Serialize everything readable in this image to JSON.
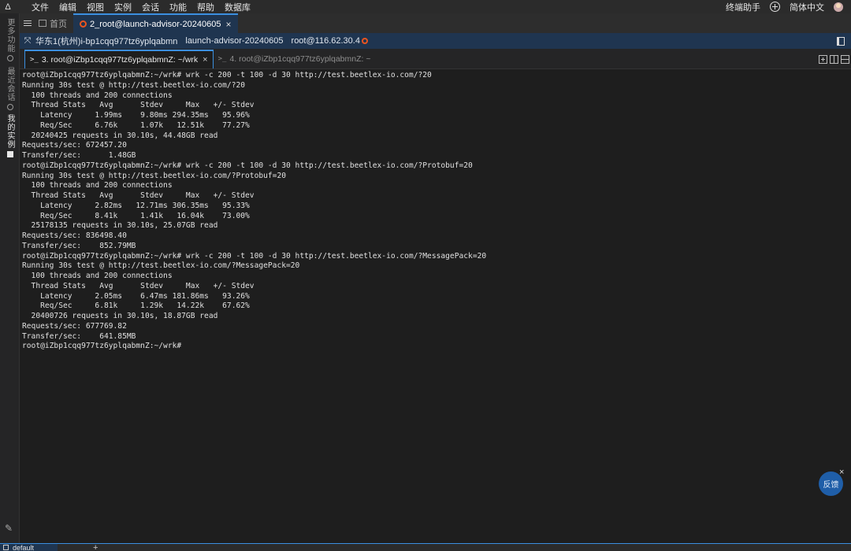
{
  "menubar": {
    "logo": "Δ",
    "items": [
      "文件",
      "编辑",
      "视图",
      "实例",
      "会话",
      "功能",
      "帮助",
      "数据库"
    ],
    "terminal_assistant": "终端助手",
    "language": "简体中文"
  },
  "sidebar": {
    "tabs": [
      {
        "label": "更多功能"
      },
      {
        "label": "我的实例"
      },
      {
        "label": "最近会话"
      }
    ]
  },
  "tabbar": {
    "home_label": "首页",
    "session_tab_label": "2_root@launch-advisor-20240605",
    "close_glyph": "×"
  },
  "infobar": {
    "region": "华东1(杭州)",
    "instance_id": "i-bp1cqq977tz6yplqabmn",
    "instance_name": "launch-advisor-20240605",
    "user_host": "root@116.62.30.4"
  },
  "subtabs": [
    {
      "label": "3. root@iZbp1cqq977tz6yplqabmnZ: ~/wrk"
    },
    {
      "label": "4. root@iZbp1cqq977tz6yplqabmnZ: ~"
    }
  ],
  "terminal": {
    "lines": [
      "root@iZbp1cqq977tz6yplqabmnZ:~/wrk# wrk -c 200 -t 100 -d 30 http://test.beetlex-io.com/?20",
      "Running 30s test @ http://test.beetlex-io.com/?20",
      "  100 threads and 200 connections",
      "  Thread Stats   Avg      Stdev     Max   +/- Stdev",
      "    Latency     1.99ms    9.80ms 294.35ms   95.96%",
      "    Req/Sec     6.76k     1.07k   12.51k    77.27%",
      "  20240425 requests in 30.10s, 44.48GB read",
      "Requests/sec: 672457.20",
      "Transfer/sec:      1.48GB",
      "root@iZbp1cqq977tz6yplqabmnZ:~/wrk# wrk -c 200 -t 100 -d 30 http://test.beetlex-io.com/?Protobuf=20",
      "Running 30s test @ http://test.beetlex-io.com/?Protobuf=20",
      "  100 threads and 200 connections",
      "  Thread Stats   Avg      Stdev     Max   +/- Stdev",
      "    Latency     2.82ms   12.71ms 306.35ms   95.33%",
      "    Req/Sec     8.41k     1.41k   16.04k    73.00%",
      "  25178135 requests in 30.10s, 25.07GB read",
      "Requests/sec: 836498.40",
      "Transfer/sec:    852.79MB",
      "root@iZbp1cqq977tz6yplqabmnZ:~/wrk# wrk -c 200 -t 100 -d 30 http://test.beetlex-io.com/?MessagePack=20",
      "Running 30s test @ http://test.beetlex-io.com/?MessagePack=20",
      "  100 threads and 200 connections",
      "  Thread Stats   Avg      Stdev     Max   +/- Stdev",
      "    Latency     2.05ms    6.47ms 181.86ms   93.26%",
      "    Req/Sec     6.81k     1.29k   14.22k    67.62%",
      "  20400726 requests in 30.10s, 18.87GB read",
      "Requests/sec: 677769.82",
      "Transfer/sec:    641.85MB",
      "root@iZbp1cqq977tz6yplqabmnZ:~/wrk#"
    ]
  },
  "feedback": {
    "label": "反馈",
    "close_glyph": "×"
  },
  "bottombar": {
    "tab_label": "default",
    "add_glyph": "+"
  },
  "colors": {
    "accent": "#3b8fe0",
    "session_bar": "#1f3550",
    "ubuntu": "#e95420",
    "terminal_bg": "#1e1e1e"
  }
}
